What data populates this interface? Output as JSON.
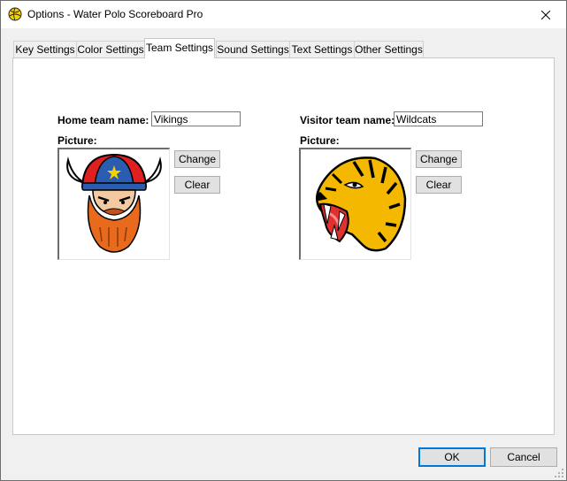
{
  "window": {
    "title": "Options - Water Polo Scoreboard Pro"
  },
  "tabs": [
    {
      "label": "Key Settings"
    },
    {
      "label": "Color Settings"
    },
    {
      "label": "Team Settings",
      "active": true
    },
    {
      "label": "Sound Settings"
    },
    {
      "label": "Text Settings"
    },
    {
      "label": "Other Settings"
    }
  ],
  "home": {
    "name_label": "Home team name:",
    "name_value": "Vikings",
    "picture_label": "Picture:",
    "picture_icon": "viking-mascot-image",
    "change_label": "Change",
    "clear_label": "Clear"
  },
  "visitor": {
    "name_label": "Visitor team name:",
    "name_value": "Wildcats",
    "picture_label": "Picture:",
    "picture_icon": "tiger-mascot-image",
    "change_label": "Change",
    "clear_label": "Clear"
  },
  "footer": {
    "ok_label": "OK",
    "cancel_label": "Cancel"
  },
  "colors": {
    "accent": "#0078d7",
    "tab_border": "#c8c8c8",
    "button_face": "#e1e1e1"
  }
}
